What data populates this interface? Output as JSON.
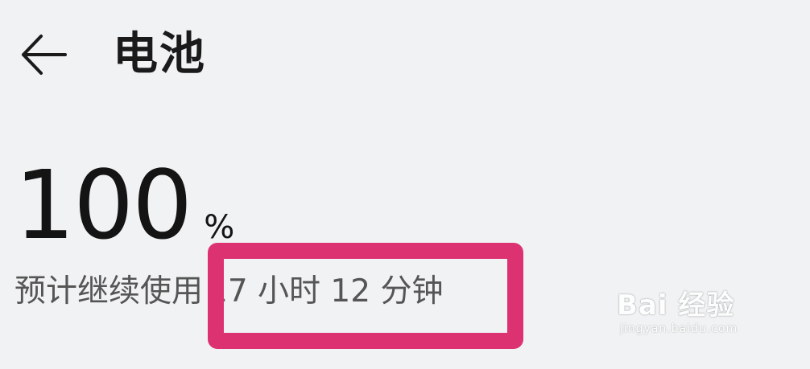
{
  "header": {
    "title": "电池",
    "back_icon": "back-arrow-icon"
  },
  "battery": {
    "level": "100",
    "unit": "%",
    "remaining_label": "预计继续使用",
    "remaining_time": "17 小时 12 分钟"
  },
  "watermark": {
    "brand": "Bai 经验",
    "url": "jingyan.baidu.com"
  },
  "colors": {
    "background": "#f1f2f4",
    "highlight": "#dd3272",
    "text_primary": "#141414",
    "text_secondary": "#555555"
  }
}
